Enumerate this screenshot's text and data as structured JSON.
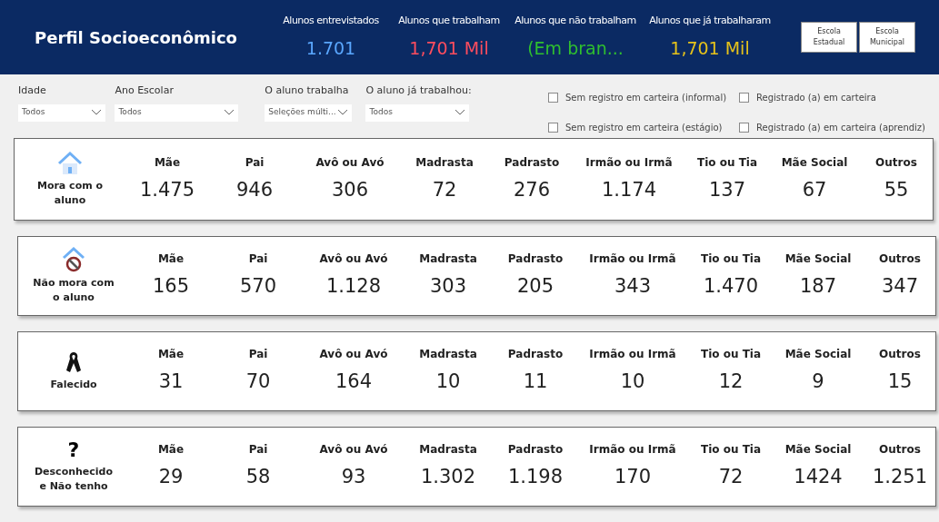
{
  "header": {
    "title": "Perfil Socioeconômico",
    "kpis": [
      {
        "label": "Alunos entrevistados",
        "value": "1.701",
        "color": "#5aa7ff"
      },
      {
        "label": "Alunos que trabalham",
        "value": "1,701 Mil",
        "color": "#ff4d5e"
      },
      {
        "label": "Alunos que não trabalham",
        "value": "(Em bran...",
        "color": "#2fbf2f"
      },
      {
        "label": "Alunos que já trabalharam",
        "value": "1,701 Mil",
        "color": "#e6c21a"
      }
    ],
    "buttons": [
      {
        "label": "Escola Estadual"
      },
      {
        "label": "Escola Municipal"
      }
    ]
  },
  "filters": [
    {
      "label": "Idade",
      "value": "Todos"
    },
    {
      "label": "Ano Escolar",
      "value": "Todos"
    },
    {
      "label": "O aluno trabalha",
      "value": "Seleções múlti..."
    },
    {
      "label": "O aluno já trabalhou:",
      "value": "Todos"
    }
  ],
  "checkboxes": [
    {
      "label": "Sem registro em carteira (informal)",
      "checked": false
    },
    {
      "label": "Registrado (a) em carteira",
      "checked": false
    },
    {
      "label": "Sem registro em carteira (estágio)",
      "checked": false
    },
    {
      "label": "Registrado (a) em carteira (aprendiz)",
      "checked": false
    }
  ],
  "cards": [
    {
      "kind": "house",
      "label": "Mora com o aluno",
      "cells": [
        {
          "label": "Mãe",
          "value": "1.475"
        },
        {
          "label": "Pai",
          "value": "946"
        },
        {
          "label": "Avô ou Avó",
          "value": "306"
        },
        {
          "label": "Madrasta",
          "value": "72"
        },
        {
          "label": "Padrasto",
          "value": "276"
        },
        {
          "label": "Irmão ou Irmã",
          "value": "1.174"
        },
        {
          "label": "Tio ou Tia",
          "value": "137"
        },
        {
          "label": "Mãe Social",
          "value": "67"
        },
        {
          "label": "Outros",
          "value": "55"
        }
      ]
    },
    {
      "kind": "no-house",
      "label": "Não mora com o aluno",
      "cells": [
        {
          "label": "Mãe",
          "value": "165"
        },
        {
          "label": "Pai",
          "value": "570"
        },
        {
          "label": "Avô ou Avó",
          "value": "1.128"
        },
        {
          "label": "Madrasta",
          "value": "303"
        },
        {
          "label": "Padrasto",
          "value": "205"
        },
        {
          "label": "Irmão ou Irmã",
          "value": "343"
        },
        {
          "label": "Tio ou Tia",
          "value": "1.470"
        },
        {
          "label": "Mãe Social",
          "value": "187"
        },
        {
          "label": "Outros",
          "value": "347"
        }
      ]
    },
    {
      "kind": "ribbon",
      "label": "Falecido",
      "cells": [
        {
          "label": "Mãe",
          "value": "31"
        },
        {
          "label": "Pai",
          "value": "70"
        },
        {
          "label": "Avô ou Avó",
          "value": "164"
        },
        {
          "label": "Madrasta",
          "value": "10"
        },
        {
          "label": "Padrasto",
          "value": "11"
        },
        {
          "label": "Irmão ou Irmã",
          "value": "10"
        },
        {
          "label": "Tio ou Tia",
          "value": "12"
        },
        {
          "label": "Mãe Social",
          "value": "9"
        },
        {
          "label": "Outros",
          "value": "15"
        }
      ]
    },
    {
      "kind": "question",
      "symbol": "?",
      "label": "Desconhecido e Não tenho",
      "cells": [
        {
          "label": "Mãe",
          "value": "29"
        },
        {
          "label": "Pai",
          "value": "58"
        },
        {
          "label": "Avô ou Avó",
          "value": "93"
        },
        {
          "label": "Madrasta",
          "value": "1.302"
        },
        {
          "label": "Padrasto",
          "value": "1.198"
        },
        {
          "label": "Irmão ou Irmã",
          "value": "170"
        },
        {
          "label": "Tio ou Tia",
          "value": "72"
        },
        {
          "label": "Mãe Social",
          "value": "1424"
        },
        {
          "label": "Outros",
          "value": "1.251"
        }
      ]
    }
  ]
}
